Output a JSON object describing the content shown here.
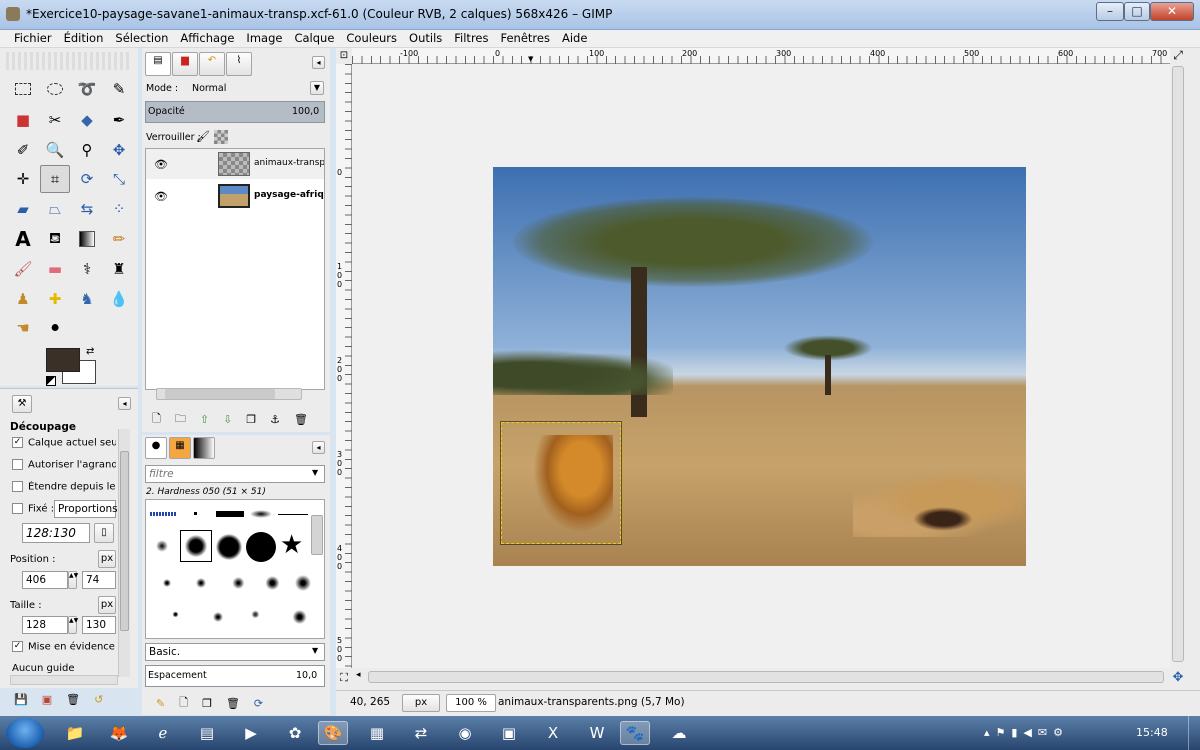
{
  "window": {
    "title": "*Exercice10-paysage-savane1-animaux-transp.xcf-61.0 (Couleur RVB, 2 calques) 568x426 – GIMP",
    "controls": {
      "minimize": "–",
      "maximize": "□",
      "close": "✕"
    }
  },
  "menu": [
    "Fichier",
    "Édition",
    "Sélection",
    "Affichage",
    "Image",
    "Calque",
    "Couleurs",
    "Outils",
    "Filtres",
    "Fenêtres",
    "Aide"
  ],
  "tool_options": {
    "title": "Découpage",
    "current_layer_only": "Calque actuel seulem",
    "allow_growing": "Autoriser l'agrandisse",
    "expand_from_center": "Étendre depuis le cen",
    "fixed_label": "Fixé :",
    "fixed_value": "Proportions",
    "ratio": "128:130",
    "position_label": "Position :",
    "position_unit": "px",
    "position_x": "406",
    "position_y": "74",
    "size_label": "Taille :",
    "size_unit": "px",
    "size_w": "128",
    "size_h": "130",
    "highlight": "Mise en évidence",
    "guides": "Aucun guide"
  },
  "layers": {
    "mode_label": "Mode :",
    "mode_value": "Normal",
    "opacity_label": "Opacité",
    "opacity_value": "100,0",
    "lock_label": "Verrouiller :",
    "items": [
      {
        "name": "animaux-transpa",
        "visible": true
      },
      {
        "name": "paysage-afrique",
        "visible": true
      }
    ]
  },
  "brushes": {
    "filter_placeholder": "filtre",
    "current": "2. Hardness 050 (51 × 51)",
    "tag": "Basic.",
    "spacing_label": "Espacement",
    "spacing_value": "10,0"
  },
  "canvas": {
    "ruler_labels": [
      "-100",
      "0",
      "100",
      "200",
      "300",
      "400",
      "500",
      "600",
      "700"
    ],
    "vruler_labels": [
      "0",
      "100",
      "200",
      "300",
      "400",
      "500"
    ]
  },
  "status": {
    "coords": "40, 265",
    "unit": "px",
    "zoom": "100 %",
    "message": "animaux-transparents.png (5,7 Mo)"
  },
  "taskbar": {
    "time": "15:48"
  }
}
